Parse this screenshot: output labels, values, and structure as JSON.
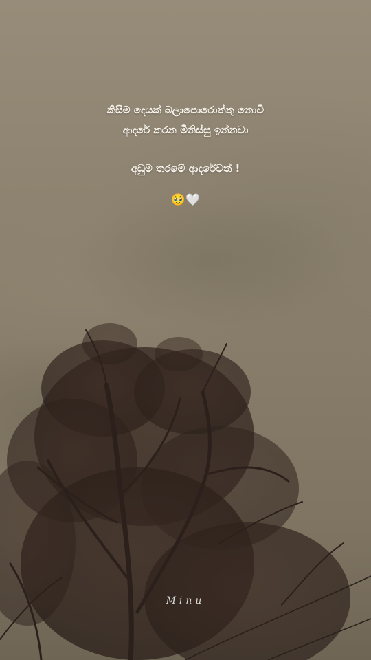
{
  "quote": {
    "line1": "කිසිම දෙයක් බලාපොරොත්තු නොවී",
    "line2": "ආදරේ කරන මිනිස්සු ඉන්නවා",
    "line3": "අඩුම තරමේ ආදරේවත් !"
  },
  "emoji": "🥹🤍",
  "signature": "Minu",
  "colors": {
    "sky": "#8b7f6d",
    "text": "#f7f3ec",
    "tree": "#2a1f1a"
  }
}
